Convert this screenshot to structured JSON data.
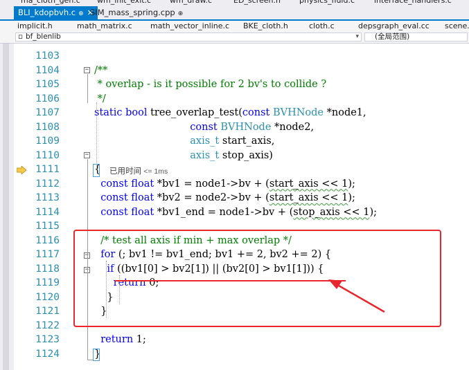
{
  "tabs_row0": [
    "ma_cloth_gen.c",
    "wm_init_exit.c",
    "wm_draw.c",
    "ED_screen.h",
    "physics_fluid.c",
    "interface_handlers.c"
  ],
  "tabs_row1": [
    {
      "label": "BLI_kdopbvh.c",
      "active": true,
      "pin": "⊕",
      "close": "✕"
    },
    {
      "label": "SIM_mass_spring.cpp",
      "active": false,
      "pin": "⊕"
    }
  ],
  "tabs_row2": [
    "implicit.h",
    "math_matrix.c",
    "math_vector_inline.c",
    "BKE_cloth.h",
    "cloth.c",
    "depsgraph_eval.cc",
    "scene.c"
  ],
  "navbar": {
    "project": "bf_blenlib",
    "scope": "(全局范围)",
    "dropdown_arrow": "▾"
  },
  "code_hint": {
    "label": "已用时间",
    "value": "<= 1ms"
  },
  "lines": [
    {
      "num": "1103",
      "parts": []
    },
    {
      "num": "1104",
      "parts": [
        {
          "t": "/**",
          "c": "cm"
        }
      ]
    },
    {
      "num": "1105",
      "parts": [
        {
          "t": " * overlap - is it possible for 2 bv's to collide ?",
          "c": "cm"
        }
      ]
    },
    {
      "num": "1106",
      "parts": [
        {
          "t": " */",
          "c": "cm"
        }
      ]
    },
    {
      "num": "1107",
      "parts": [
        {
          "t": "static ",
          "c": "kw"
        },
        {
          "t": "bool ",
          "c": "kw"
        },
        {
          "t": "tree_overlap_test(",
          "c": "nm"
        },
        {
          "t": "const ",
          "c": "kw"
        },
        {
          "t": "BVHNode ",
          "c": "ty"
        },
        {
          "t": "*node1,",
          "c": "nm"
        }
      ]
    },
    {
      "num": "1108",
      "parts": [
        {
          "t": "                              ",
          "c": "nm"
        },
        {
          "t": "const ",
          "c": "kw"
        },
        {
          "t": "BVHNode ",
          "c": "ty"
        },
        {
          "t": "*node2,",
          "c": "nm"
        }
      ]
    },
    {
      "num": "1109",
      "parts": [
        {
          "t": "                              ",
          "c": "nm"
        },
        {
          "t": "axis_t ",
          "c": "ty"
        },
        {
          "t": "start_axis,",
          "c": "nm"
        }
      ]
    },
    {
      "num": "1110",
      "parts": [
        {
          "t": "                              ",
          "c": "nm"
        },
        {
          "t": "axis_t ",
          "c": "ty"
        },
        {
          "t": "stop_axis)",
          "c": "nm"
        }
      ]
    },
    {
      "num": "1111",
      "parts": [
        {
          "t": "{",
          "c": "nm"
        }
      ]
    },
    {
      "num": "1112",
      "parts": [
        {
          "t": "  const ",
          "c": "kw"
        },
        {
          "t": "float ",
          "c": "kw"
        },
        {
          "t": "*bv1 = node1->bv + (",
          "c": "nm"
        },
        {
          "t": "start_axis << 1",
          "c": "sq"
        },
        {
          "t": ");",
          "c": "nm"
        }
      ]
    },
    {
      "num": "1113",
      "parts": [
        {
          "t": "  const ",
          "c": "kw"
        },
        {
          "t": "float ",
          "c": "kw"
        },
        {
          "t": "*bv2 = node2->bv + (",
          "c": "nm"
        },
        {
          "t": "start_axis << 1",
          "c": "sq"
        },
        {
          "t": ");",
          "c": "nm"
        }
      ]
    },
    {
      "num": "1114",
      "parts": [
        {
          "t": "  const ",
          "c": "kw"
        },
        {
          "t": "float ",
          "c": "kw"
        },
        {
          "t": "*bv1_end = node1->bv + (",
          "c": "nm"
        },
        {
          "t": "stop_axis << 1",
          "c": "sq"
        },
        {
          "t": ");",
          "c": "nm"
        }
      ]
    },
    {
      "num": "1115",
      "parts": []
    },
    {
      "num": "1116",
      "parts": [
        {
          "t": "  /* test all axis if min + max overlap */",
          "c": "cm"
        }
      ]
    },
    {
      "num": "1117",
      "parts": [
        {
          "t": "  for ",
          "c": "kw"
        },
        {
          "t": "(; bv1 != bv1_end; bv1 += 2, bv2 += 2) {",
          "c": "nm"
        }
      ]
    },
    {
      "num": "1118",
      "parts": [
        {
          "t": "    if ",
          "c": "kw"
        },
        {
          "t": "((bv1[0] > bv2[1]) || (bv2[0] > bv1[1])) {",
          "c": "nm"
        }
      ]
    },
    {
      "num": "1119",
      "parts": [
        {
          "t": "      return ",
          "c": "kw"
        },
        {
          "t": "0;",
          "c": "nm"
        }
      ]
    },
    {
      "num": "1120",
      "parts": [
        {
          "t": "    }",
          "c": "nm"
        }
      ]
    },
    {
      "num": "1121",
      "parts": [
        {
          "t": "  }",
          "c": "nm"
        }
      ]
    },
    {
      "num": "1122",
      "parts": []
    },
    {
      "num": "1123",
      "parts": [
        {
          "t": "  return ",
          "c": "kw"
        },
        {
          "t": "1;",
          "c": "nm"
        }
      ]
    },
    {
      "num": "1124",
      "parts": [
        {
          "t": "}",
          "c": "nm"
        }
      ]
    }
  ],
  "colors": {
    "keyword": "#0000ff",
    "type": "#2b91af",
    "comment": "#008000",
    "line_number": "#2b91af",
    "active_tab": "#007acc",
    "annotation_red": "#e8262b"
  }
}
